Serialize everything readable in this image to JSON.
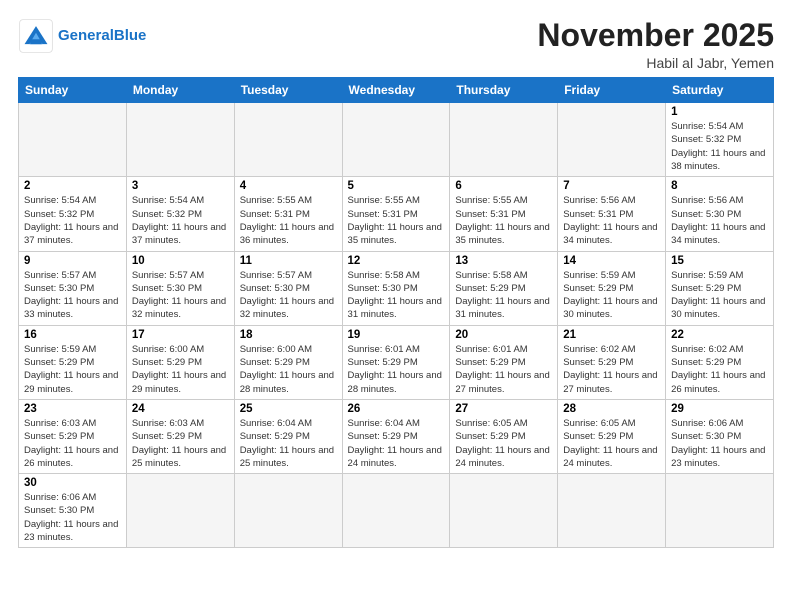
{
  "header": {
    "logo_general": "General",
    "logo_blue": "Blue",
    "month_title": "November 2025",
    "location": "Habil al Jabr, Yemen"
  },
  "weekdays": [
    "Sunday",
    "Monday",
    "Tuesday",
    "Wednesday",
    "Thursday",
    "Friday",
    "Saturday"
  ],
  "weeks": [
    [
      {
        "day": "",
        "empty": true
      },
      {
        "day": "",
        "empty": true
      },
      {
        "day": "",
        "empty": true
      },
      {
        "day": "",
        "empty": true
      },
      {
        "day": "",
        "empty": true
      },
      {
        "day": "",
        "empty": true
      },
      {
        "day": "1",
        "sunrise": "5:54 AM",
        "sunset": "5:32 PM",
        "daylight": "11 hours and 38 minutes."
      }
    ],
    [
      {
        "day": "2",
        "sunrise": "5:54 AM",
        "sunset": "5:32 PM",
        "daylight": "11 hours and 37 minutes."
      },
      {
        "day": "3",
        "sunrise": "5:54 AM",
        "sunset": "5:32 PM",
        "daylight": "11 hours and 37 minutes."
      },
      {
        "day": "4",
        "sunrise": "5:55 AM",
        "sunset": "5:31 PM",
        "daylight": "11 hours and 36 minutes."
      },
      {
        "day": "5",
        "sunrise": "5:55 AM",
        "sunset": "5:31 PM",
        "daylight": "11 hours and 35 minutes."
      },
      {
        "day": "6",
        "sunrise": "5:55 AM",
        "sunset": "5:31 PM",
        "daylight": "11 hours and 35 minutes."
      },
      {
        "day": "7",
        "sunrise": "5:56 AM",
        "sunset": "5:31 PM",
        "daylight": "11 hours and 34 minutes."
      },
      {
        "day": "8",
        "sunrise": "5:56 AM",
        "sunset": "5:30 PM",
        "daylight": "11 hours and 34 minutes."
      }
    ],
    [
      {
        "day": "9",
        "sunrise": "5:57 AM",
        "sunset": "5:30 PM",
        "daylight": "11 hours and 33 minutes."
      },
      {
        "day": "10",
        "sunrise": "5:57 AM",
        "sunset": "5:30 PM",
        "daylight": "11 hours and 32 minutes."
      },
      {
        "day": "11",
        "sunrise": "5:57 AM",
        "sunset": "5:30 PM",
        "daylight": "11 hours and 32 minutes."
      },
      {
        "day": "12",
        "sunrise": "5:58 AM",
        "sunset": "5:30 PM",
        "daylight": "11 hours and 31 minutes."
      },
      {
        "day": "13",
        "sunrise": "5:58 AM",
        "sunset": "5:29 PM",
        "daylight": "11 hours and 31 minutes."
      },
      {
        "day": "14",
        "sunrise": "5:59 AM",
        "sunset": "5:29 PM",
        "daylight": "11 hours and 30 minutes."
      },
      {
        "day": "15",
        "sunrise": "5:59 AM",
        "sunset": "5:29 PM",
        "daylight": "11 hours and 30 minutes."
      }
    ],
    [
      {
        "day": "16",
        "sunrise": "5:59 AM",
        "sunset": "5:29 PM",
        "daylight": "11 hours and 29 minutes."
      },
      {
        "day": "17",
        "sunrise": "6:00 AM",
        "sunset": "5:29 PM",
        "daylight": "11 hours and 29 minutes."
      },
      {
        "day": "18",
        "sunrise": "6:00 AM",
        "sunset": "5:29 PM",
        "daylight": "11 hours and 28 minutes."
      },
      {
        "day": "19",
        "sunrise": "6:01 AM",
        "sunset": "5:29 PM",
        "daylight": "11 hours and 28 minutes."
      },
      {
        "day": "20",
        "sunrise": "6:01 AM",
        "sunset": "5:29 PM",
        "daylight": "11 hours and 27 minutes."
      },
      {
        "day": "21",
        "sunrise": "6:02 AM",
        "sunset": "5:29 PM",
        "daylight": "11 hours and 27 minutes."
      },
      {
        "day": "22",
        "sunrise": "6:02 AM",
        "sunset": "5:29 PM",
        "daylight": "11 hours and 26 minutes."
      }
    ],
    [
      {
        "day": "23",
        "sunrise": "6:03 AM",
        "sunset": "5:29 PM",
        "daylight": "11 hours and 26 minutes."
      },
      {
        "day": "24",
        "sunrise": "6:03 AM",
        "sunset": "5:29 PM",
        "daylight": "11 hours and 25 minutes."
      },
      {
        "day": "25",
        "sunrise": "6:04 AM",
        "sunset": "5:29 PM",
        "daylight": "11 hours and 25 minutes."
      },
      {
        "day": "26",
        "sunrise": "6:04 AM",
        "sunset": "5:29 PM",
        "daylight": "11 hours and 24 minutes."
      },
      {
        "day": "27",
        "sunrise": "6:05 AM",
        "sunset": "5:29 PM",
        "daylight": "11 hours and 24 minutes."
      },
      {
        "day": "28",
        "sunrise": "6:05 AM",
        "sunset": "5:29 PM",
        "daylight": "11 hours and 24 minutes."
      },
      {
        "day": "29",
        "sunrise": "6:06 AM",
        "sunset": "5:30 PM",
        "daylight": "11 hours and 23 minutes."
      }
    ],
    [
      {
        "day": "30",
        "sunrise": "6:06 AM",
        "sunset": "5:30 PM",
        "daylight": "11 hours and 23 minutes."
      },
      {
        "day": "",
        "empty": true
      },
      {
        "day": "",
        "empty": true
      },
      {
        "day": "",
        "empty": true
      },
      {
        "day": "",
        "empty": true
      },
      {
        "day": "",
        "empty": true
      },
      {
        "day": "",
        "empty": true
      }
    ]
  ],
  "labels": {
    "sunrise": "Sunrise:",
    "sunset": "Sunset:",
    "daylight": "Daylight:"
  }
}
